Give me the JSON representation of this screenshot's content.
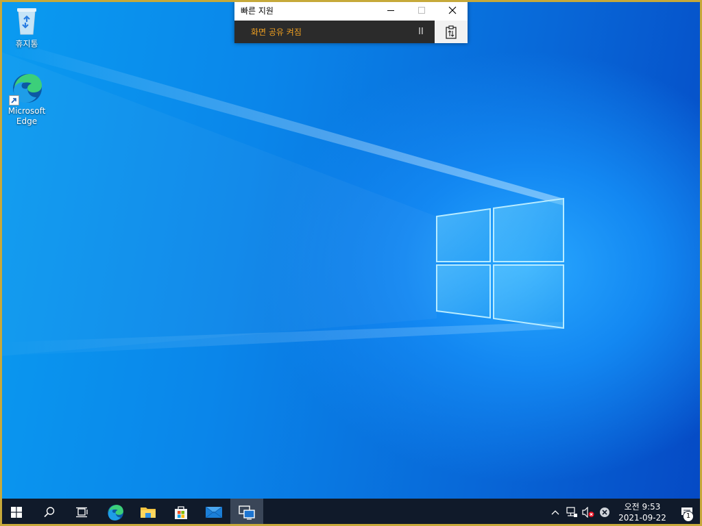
{
  "desktop": {
    "icons": [
      {
        "label": "휴지통",
        "icon": "recycle-bin-icon"
      },
      {
        "label": "Microsoft Edge",
        "icon": "edge-icon"
      }
    ]
  },
  "quick_assist": {
    "title": "빠른 지원",
    "status": "화면 공유 켜짐",
    "pause_label": "II",
    "status_color": "#f0a020"
  },
  "taskbar": {
    "pinned": [
      {
        "name": "start-button",
        "icon": "windows-logo-icon"
      },
      {
        "name": "search-button",
        "icon": "search-icon"
      },
      {
        "name": "task-view-button",
        "icon": "task-view-icon"
      },
      {
        "name": "edge-button",
        "icon": "edge-icon"
      },
      {
        "name": "file-explorer-button",
        "icon": "folder-icon"
      },
      {
        "name": "store-button",
        "icon": "store-icon"
      },
      {
        "name": "mail-button",
        "icon": "mail-icon"
      },
      {
        "name": "quick-assist-button",
        "icon": "quick-assist-icon",
        "active": true
      }
    ],
    "tray": {
      "time": "오전 9:53",
      "date": "2021-09-22",
      "notification_count": "1"
    }
  },
  "colors": {
    "taskbar": "#101a2a",
    "accent": "#76b9ed",
    "border": "#c6a93a"
  }
}
